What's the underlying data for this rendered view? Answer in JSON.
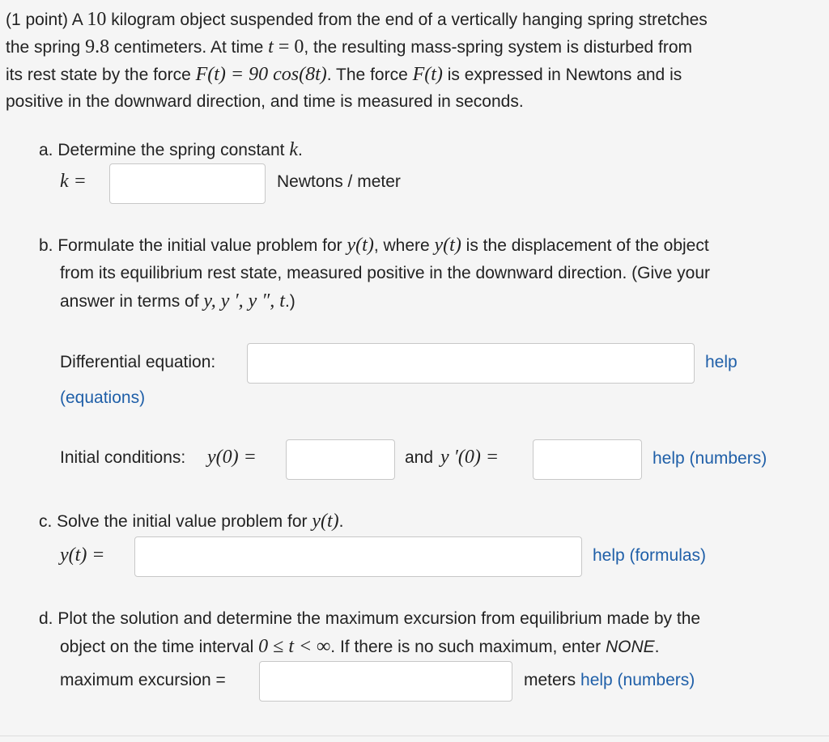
{
  "problem": {
    "intro_p1": "(1 point) A ",
    "mass": "10",
    "intro_p2": " kilogram object suspended from the end of a vertically hanging spring stretches",
    "line2_p1": "the spring ",
    "stretch": "9.8",
    "line2_p2": " centimeters. At time ",
    "t_var": "t",
    "eq_zero": " = 0",
    "line2_p3": ", the resulting mass-spring system is disturbed from",
    "line3_p1": "its rest state by the force ",
    "force_expr": "F(t) = 90 cos(8t)",
    "line3_p2": ". The force ",
    "force_name": "F(t)",
    "line3_p3": " is expressed in Newtons and is",
    "line4": "positive in the downward direction, and time is measured in seconds."
  },
  "part_a": {
    "prompt": "a. Determine the spring constant ",
    "k_var": "k",
    "dot": ".",
    "label": "k =",
    "unit": "Newtons / meter",
    "value": ""
  },
  "part_b": {
    "line1_p1": "b. Formulate the initial value problem for ",
    "y_of_t": "y(t)",
    "line1_p2": ", where ",
    "line1_p3": " is the displacement of the object",
    "line2": "from its equilibrium rest state, measured positive in the downward direction. (Give your",
    "line3_p1": "answer in terms of ",
    "vars": "y, y ′, y ″, t",
    "line3_p2": ".)",
    "de_label": "Differential equation:",
    "de_value": "",
    "help": "help",
    "help_eq": "(equations)",
    "ic_label": "Initial conditions: ",
    "y0": "y(0) =",
    "and": "and ",
    "yp0": "y ′(0) =",
    "y0_value": "",
    "yp0_value": "",
    "help_numbers": "help (numbers)"
  },
  "part_c": {
    "prompt": "c. Solve the initial value problem for ",
    "y_of_t": "y(t)",
    "dot": ".",
    "label": "y(t) =",
    "value": "",
    "help_formulas": "help (formulas)"
  },
  "part_d": {
    "line1": "d. Plot the solution and determine the maximum excursion from equilibrium made by the",
    "line2_p1": "object on the time interval ",
    "interval": "0 ≤ t < ∞",
    "line2_p2": ". If there is no such maximum, enter ",
    "none": "NONE",
    "line2_p3": ".",
    "label": "maximum excursion =",
    "value": "",
    "unit": "meters ",
    "help_numbers": "help (numbers)"
  }
}
